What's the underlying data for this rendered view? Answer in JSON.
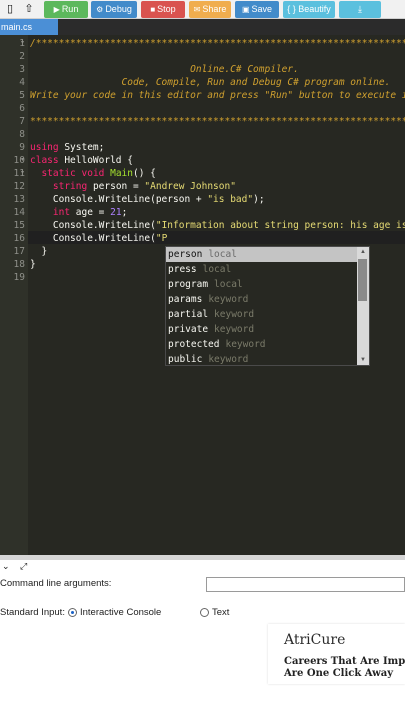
{
  "toolbar": {
    "buttons": [
      {
        "label": "Run",
        "icon": "play-icon",
        "glyph": "▶",
        "color": "#5cb85c"
      },
      {
        "label": "Debug",
        "icon": "debug-icon",
        "glyph": "⚙",
        "color": "#428bca"
      },
      {
        "label": "Stop",
        "icon": "stop-icon",
        "glyph": "■",
        "color": "#d9534f"
      },
      {
        "label": "Share",
        "icon": "share-icon",
        "glyph": "✉",
        "color": "#f0ad4e"
      },
      {
        "label": "Save",
        "icon": "save-icon",
        "glyph": "▣",
        "color": "#428bca"
      },
      {
        "label": "{ } Beautify",
        "icon": "beautify-icon",
        "glyph": "",
        "color": "#5bc0de"
      },
      {
        "label": "",
        "icon": "download-icon",
        "glyph": "⤓",
        "color": "#5bc0de"
      }
    ]
  },
  "tabs": [
    {
      "label": "main.cs"
    }
  ],
  "editor": {
    "lines": [
      {
        "n": "1",
        "fold": "▾"
      },
      {
        "n": "2"
      },
      {
        "n": "3"
      },
      {
        "n": "4"
      },
      {
        "n": "5"
      },
      {
        "n": "6"
      },
      {
        "n": "7"
      },
      {
        "n": "8"
      },
      {
        "n": "9"
      },
      {
        "n": "10",
        "fold": "▾"
      },
      {
        "n": "11",
        "fold": "▾"
      },
      {
        "n": "12"
      },
      {
        "n": "13"
      },
      {
        "n": "14"
      },
      {
        "n": "15"
      },
      {
        "n": "16"
      },
      {
        "n": "17"
      },
      {
        "n": "18"
      },
      {
        "n": "19"
      }
    ],
    "comment_stars": "/******************************************************************************",
    "comment_line4": "                            Online C# Compiler.",
    "comment_line5": "                Code, Compile, Run and Debug C# program online.",
    "comment_line6": "Write your code in this editor and press \"Run\" button to execute it.",
    "comment_end": "*******************************************************************************/",
    "using_kw": "using",
    "using_rest": " System;",
    "class_kw": "class",
    "class_name": " HelloWorld",
    "class_brace": " {",
    "static_kw": "static",
    "void_kw": " void",
    "main_fn": " Main",
    "main_rest": "() {",
    "string_kw": "string",
    "person_decl": " person = ",
    "person_val": "\"Andrew Johnson\"",
    "console1": "Console.WriteLine(person + ",
    "is_bad": "\"is bad\"",
    "close1": ");",
    "int_kw": "int",
    "age_decl": " age = ",
    "age_val": "21",
    "semi": ";",
    "console2": "Console.WriteLine(",
    "info_str": "\"Information about string person: his age is\"",
    "console3": "Console.WriteLine(",
    "typed_str": "\"P",
    "brace_close_inner": "}",
    "brace_close_outer": "}"
  },
  "autocomplete": {
    "items": [
      {
        "name": "person",
        "meta": "local"
      },
      {
        "name": "press",
        "meta": "local"
      },
      {
        "name": "program",
        "meta": "local"
      },
      {
        "name": "params",
        "meta": "keyword"
      },
      {
        "name": "partial",
        "meta": "keyword"
      },
      {
        "name": "private",
        "meta": "keyword"
      },
      {
        "name": "protected",
        "meta": "keyword"
      },
      {
        "name": "public",
        "meta": "keyword"
      }
    ]
  },
  "bottom": {
    "cmd_label": "Command line arguments:",
    "stdin_label": "Standard Input:",
    "interactive_label": "Interactive Console",
    "text_label": "Text"
  },
  "ad": {
    "logo": "AtriCure",
    "line1": "Careers That Are Impactful",
    "line2": "Are One Click Away"
  }
}
